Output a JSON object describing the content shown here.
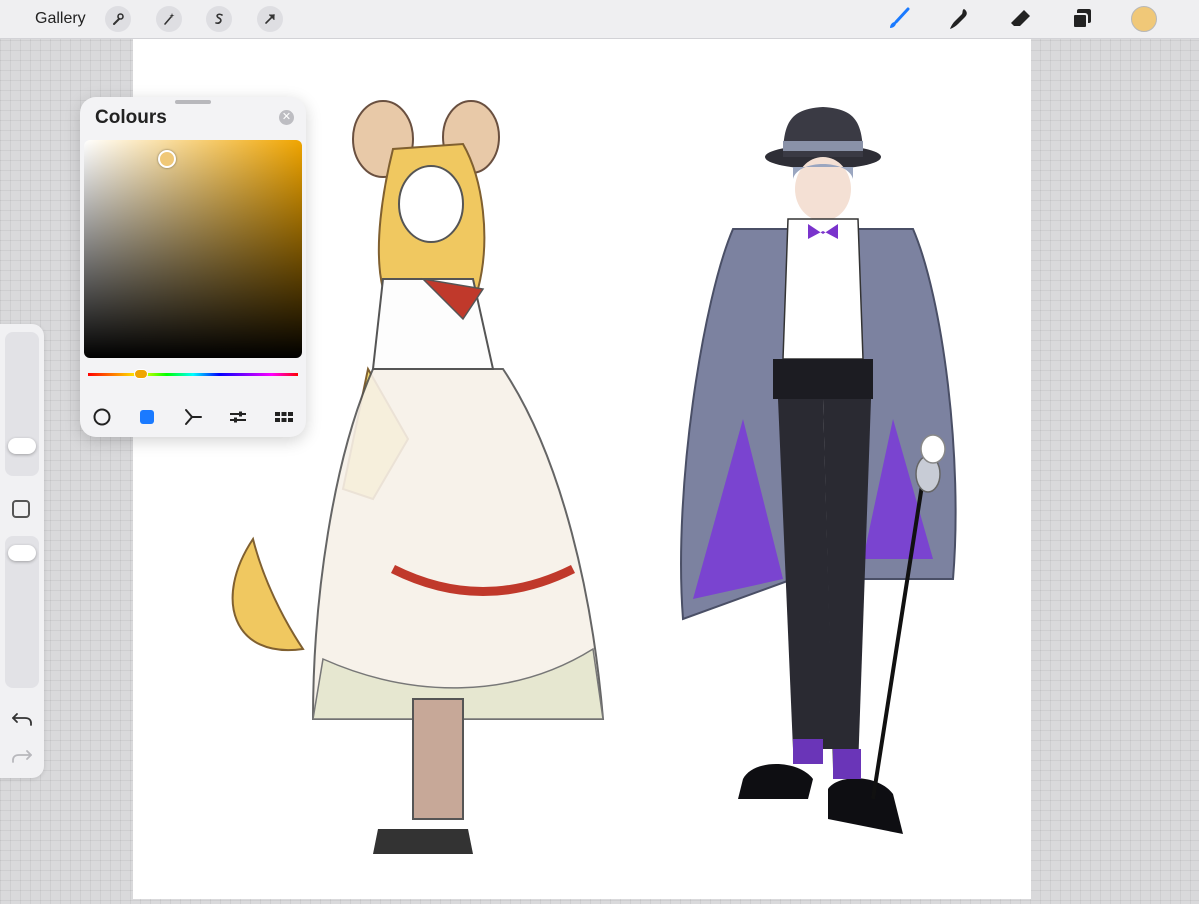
{
  "topbar": {
    "gallery_label": "Gallery",
    "left_tools": [
      "wrench-icon",
      "magic-wand-icon",
      "selection-icon",
      "transform-arrow-icon"
    ],
    "right_tools": [
      "brush-icon",
      "smudge-icon",
      "eraser-icon",
      "layers-icon"
    ],
    "current_color": "#f0c878",
    "active_tool_color": "#1a7aff"
  },
  "colour_panel": {
    "title": "Colours",
    "modes": [
      "disc-mode-icon",
      "classic-mode-icon",
      "harmony-mode-icon",
      "value-mode-icon",
      "palettes-mode-icon"
    ],
    "active_mode": "classic"
  },
  "sidebar": {
    "buttons": [
      "modify-button",
      "undo-icon",
      "redo-icon"
    ]
  }
}
